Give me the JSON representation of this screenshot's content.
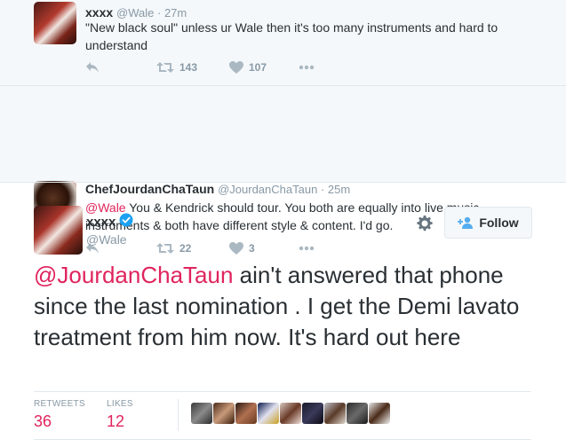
{
  "thread": [
    {
      "name": "xxxx",
      "handle": "@Wale",
      "sep": " · ",
      "time": "27m",
      "text": "\"New black soul\" unless ur Wale then it's too many instruments and hard to understand",
      "retweets": "143",
      "likes": "107"
    },
    {
      "name": "ChefJourdanChaTaun",
      "handle": "@JourdanChaTaun",
      "sep": " · ",
      "time": "25m",
      "mention": "@Wale",
      "text": " You & Kendrick should tour. You both are equally into live music, instruments & both have different style & content. I'd go.",
      "retweets": "22",
      "likes": "3"
    }
  ],
  "main": {
    "name": "xxxx",
    "handle": "@Wale",
    "follow_label": "Follow",
    "mention": "@JourdanChaTaun",
    "text": " ain't answered that phone since the last nomination . I get the Demi lavato treatment from him now. It's hard out here",
    "stats": {
      "retweets_label": "RETWEETS",
      "retweets": "36",
      "likes_label": "LIKES",
      "likes": "12"
    }
  },
  "colors": {
    "accent": "#e0245e",
    "muted": "#8899a6",
    "verified": "#1da1f2",
    "follow_icon": "#55acee"
  },
  "icons": [
    "reply-icon",
    "retweet-icon",
    "heart-icon",
    "more-icon",
    "gear-icon",
    "follow-icon",
    "verified-badge-icon"
  ]
}
